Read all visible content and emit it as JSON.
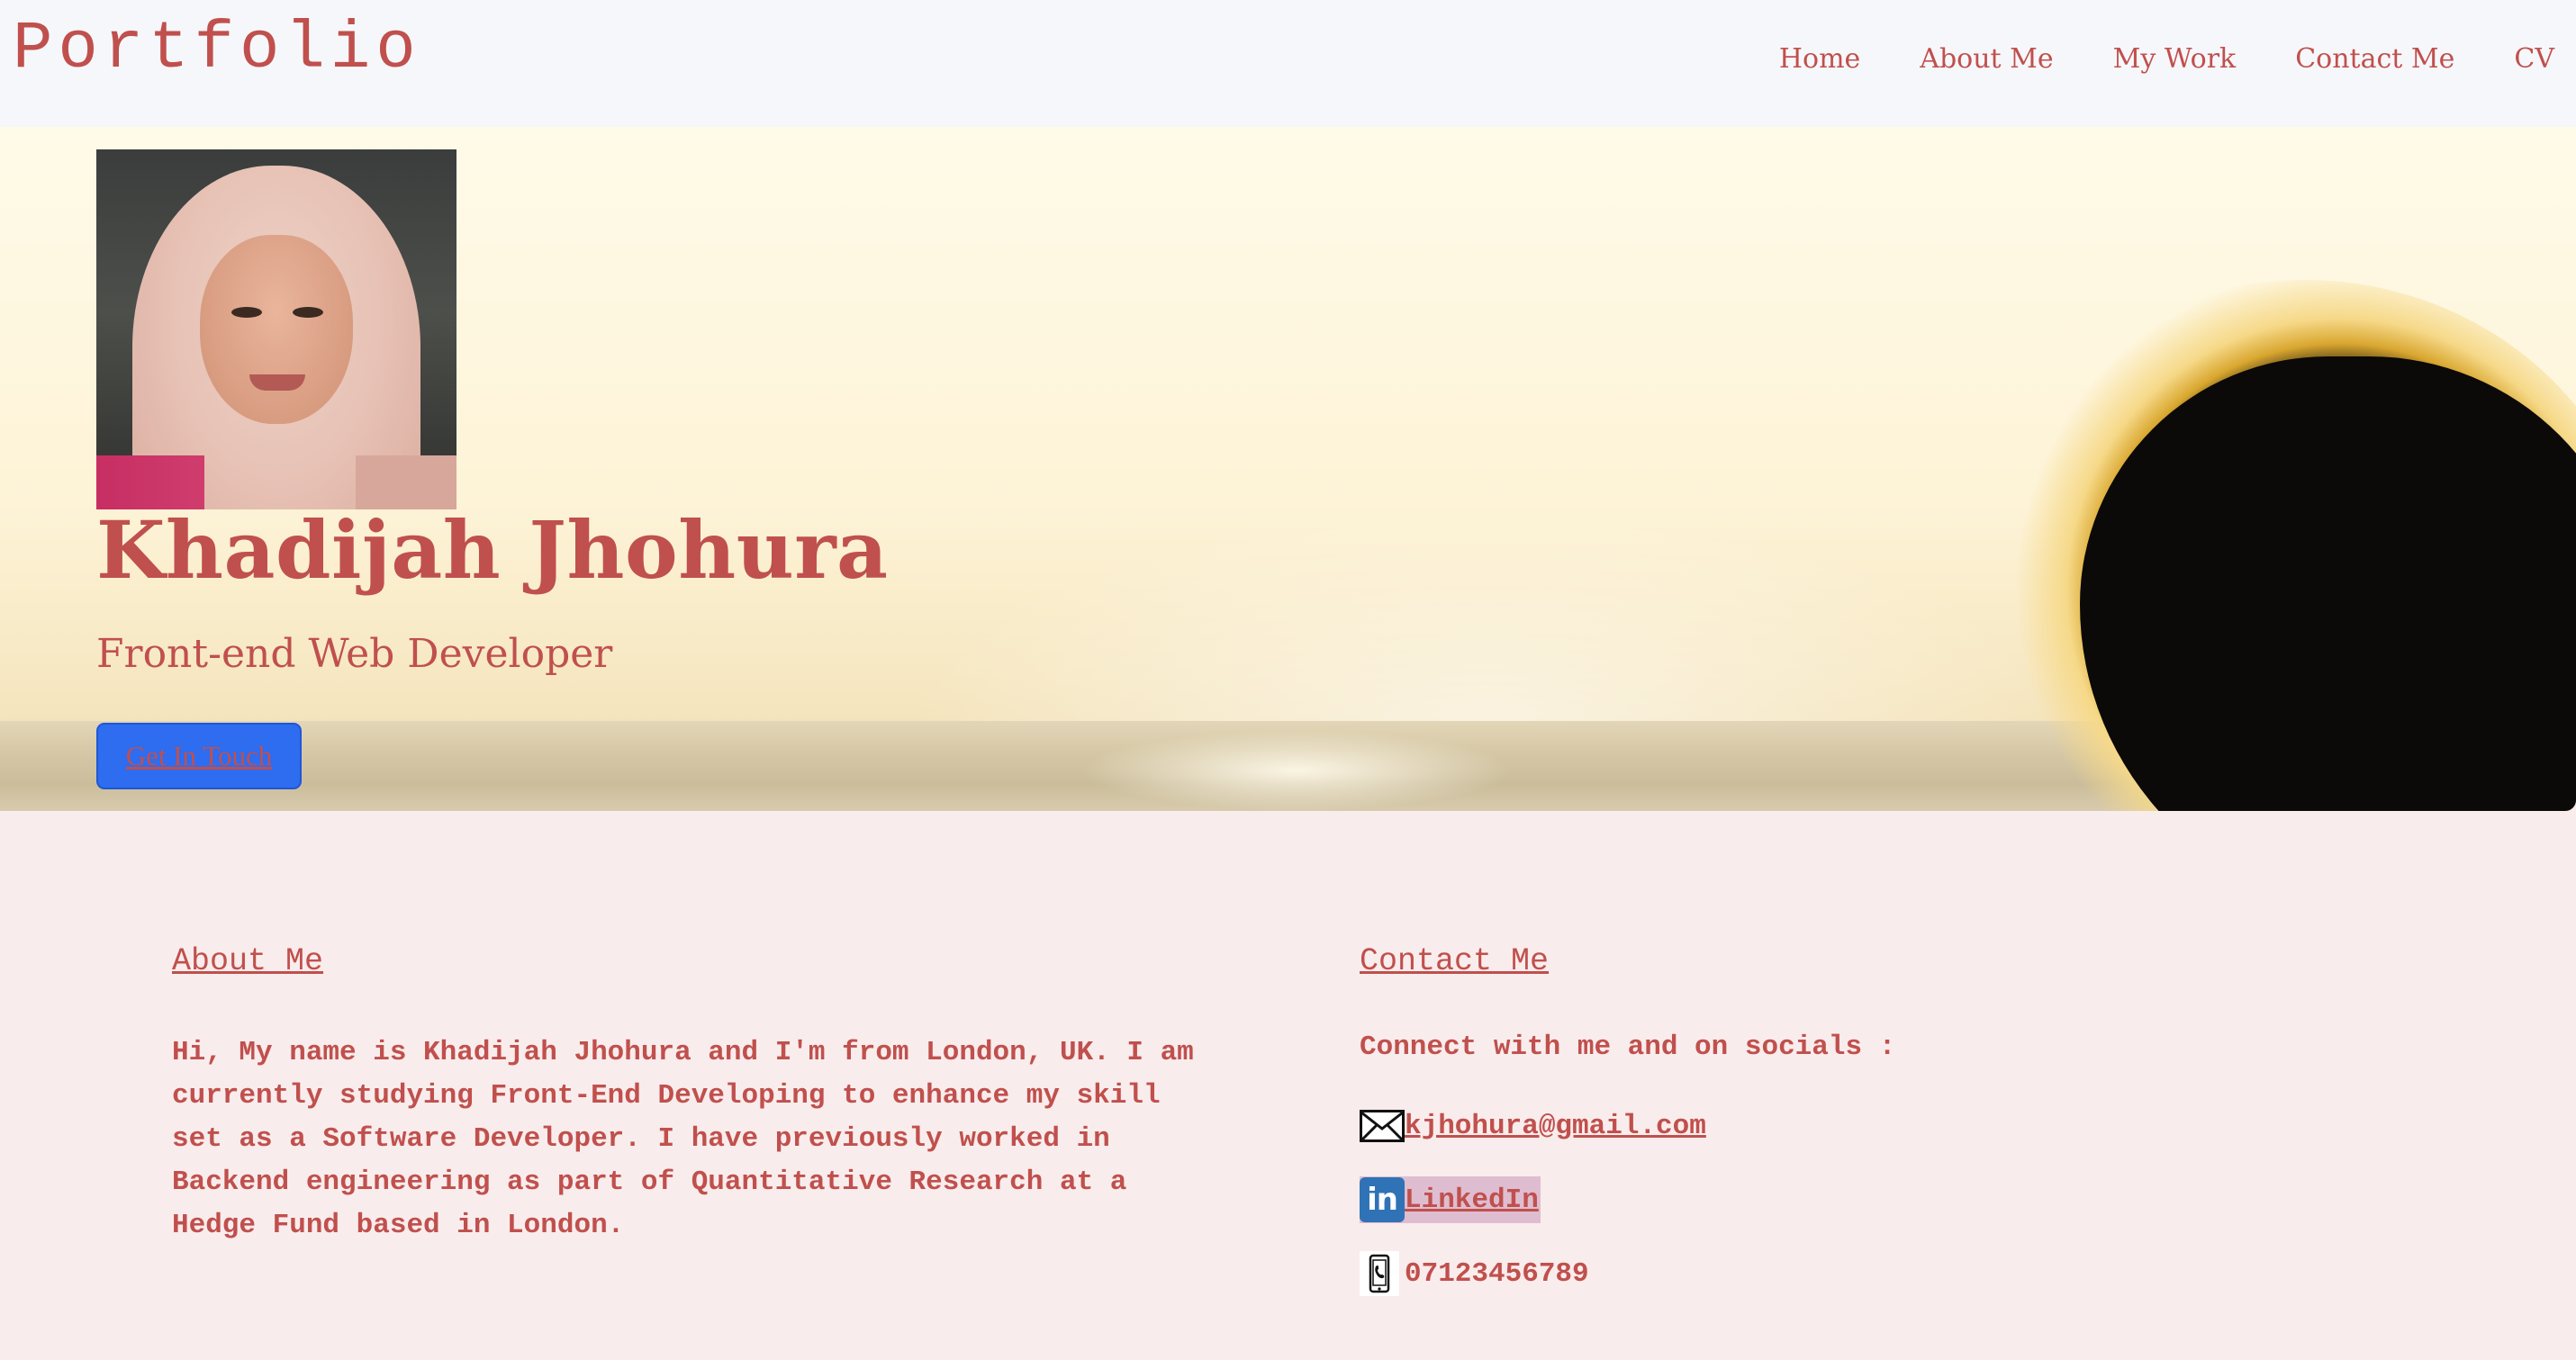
{
  "navbar": {
    "brand": "Portfolio",
    "links": [
      "Home",
      "About Me",
      "My Work",
      "Contact Me",
      "CV"
    ]
  },
  "hero": {
    "name": "Khadijah Jhohura",
    "role": "Front-end Web Developer",
    "cta_label": "Get In Touch"
  },
  "about": {
    "title": "About Me",
    "text": "Hi, My name is Khadijah Jhohura and I'm from London, UK. I am currently studying Front-End Developing to enhance my skill set as a Software Developer. I have previously worked in Backend engineering as part of Quantitative Research at a Hedge Fund based in London."
  },
  "contact": {
    "title": "Contact Me",
    "intro": "Connect with me and on socials :",
    "email": "kjhohura@gmail.com",
    "linkedin": "LinkedIn",
    "phone": "07123456789"
  },
  "icons": {
    "email": "envelope-icon",
    "linkedin": "linkedin-icon",
    "phone": "phone-icon"
  },
  "colors": {
    "text_accent": "#c0504d",
    "page_background": "#f9ecec",
    "navbar_background": "#f6f7fa",
    "cta_background": "#2e6cf0",
    "linkedin_highlight": "#dfbdd0"
  }
}
